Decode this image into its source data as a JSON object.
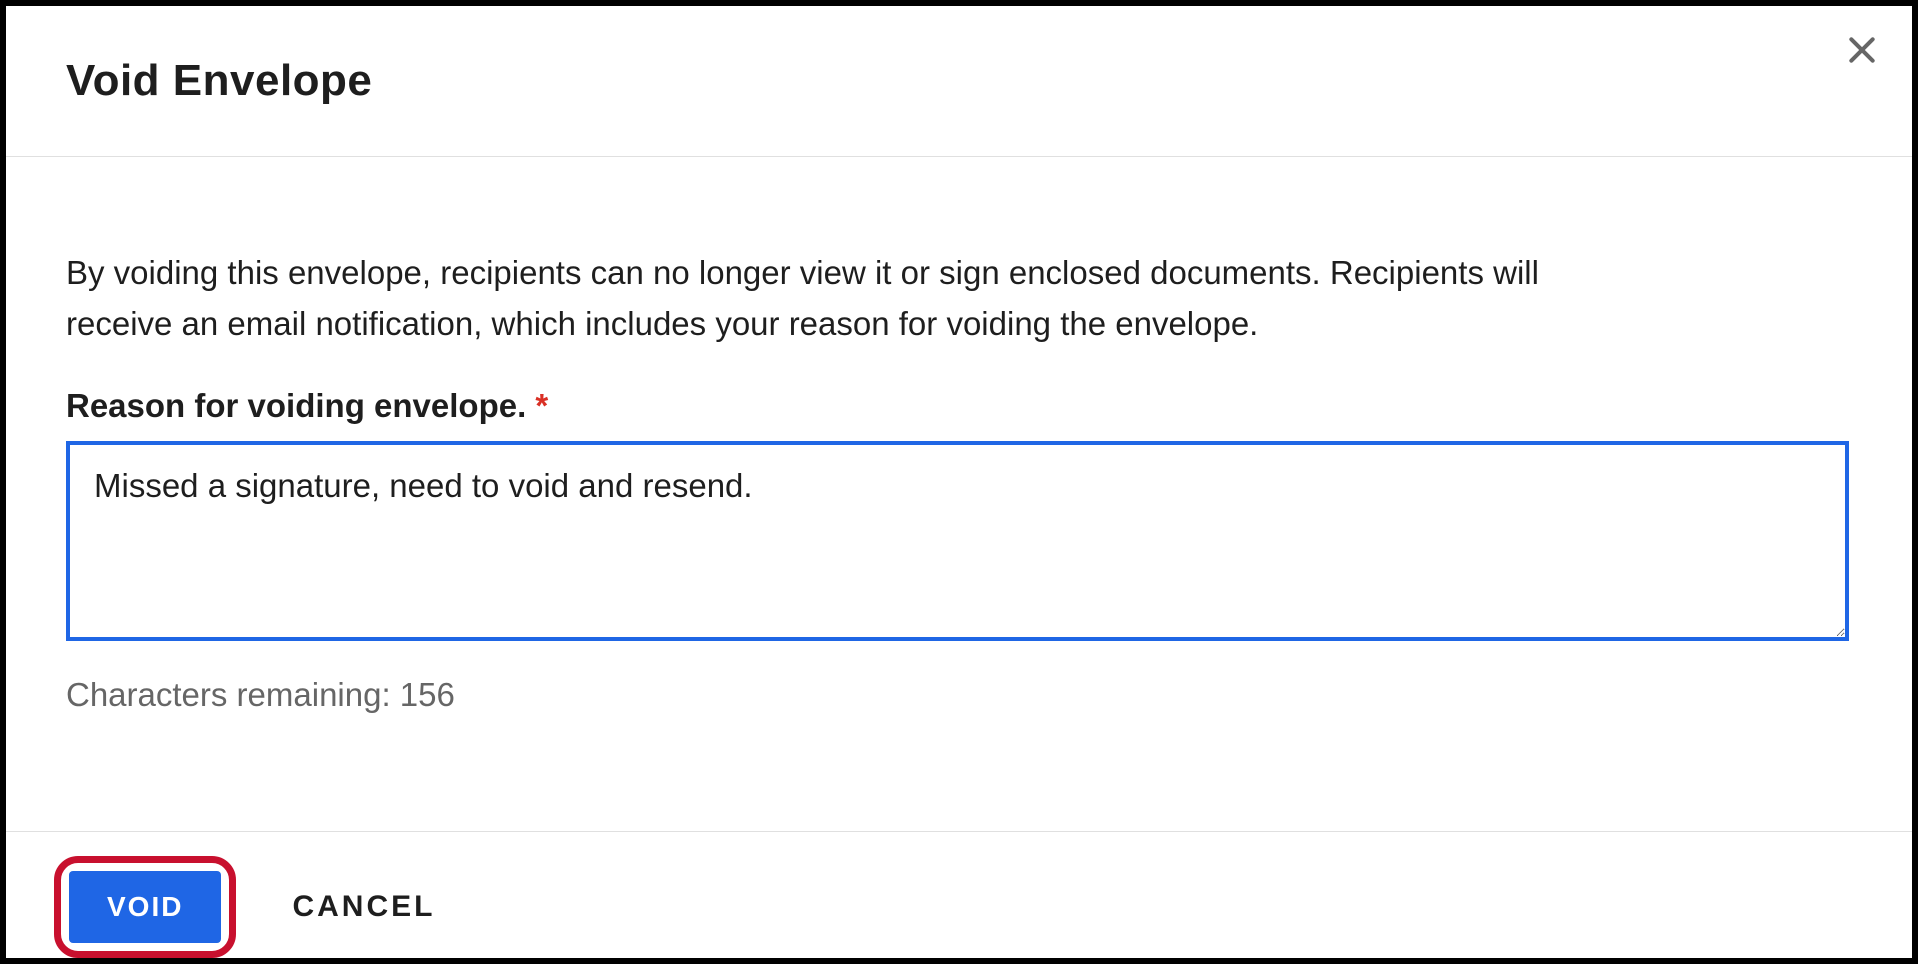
{
  "dialog": {
    "title": "Void Envelope",
    "description": "By voiding this envelope, recipients can no longer view it or sign enclosed documents. Recipients will receive an email notification, which includes your reason for voiding the envelope.",
    "field_label": "Reason for voiding envelope. ",
    "required_marker": "*",
    "reason_value": "Missed a signature, need to void and resend.",
    "chars_remaining_text": "Characters remaining: 156",
    "void_button_label": "VOID",
    "cancel_button_label": "CANCEL"
  }
}
